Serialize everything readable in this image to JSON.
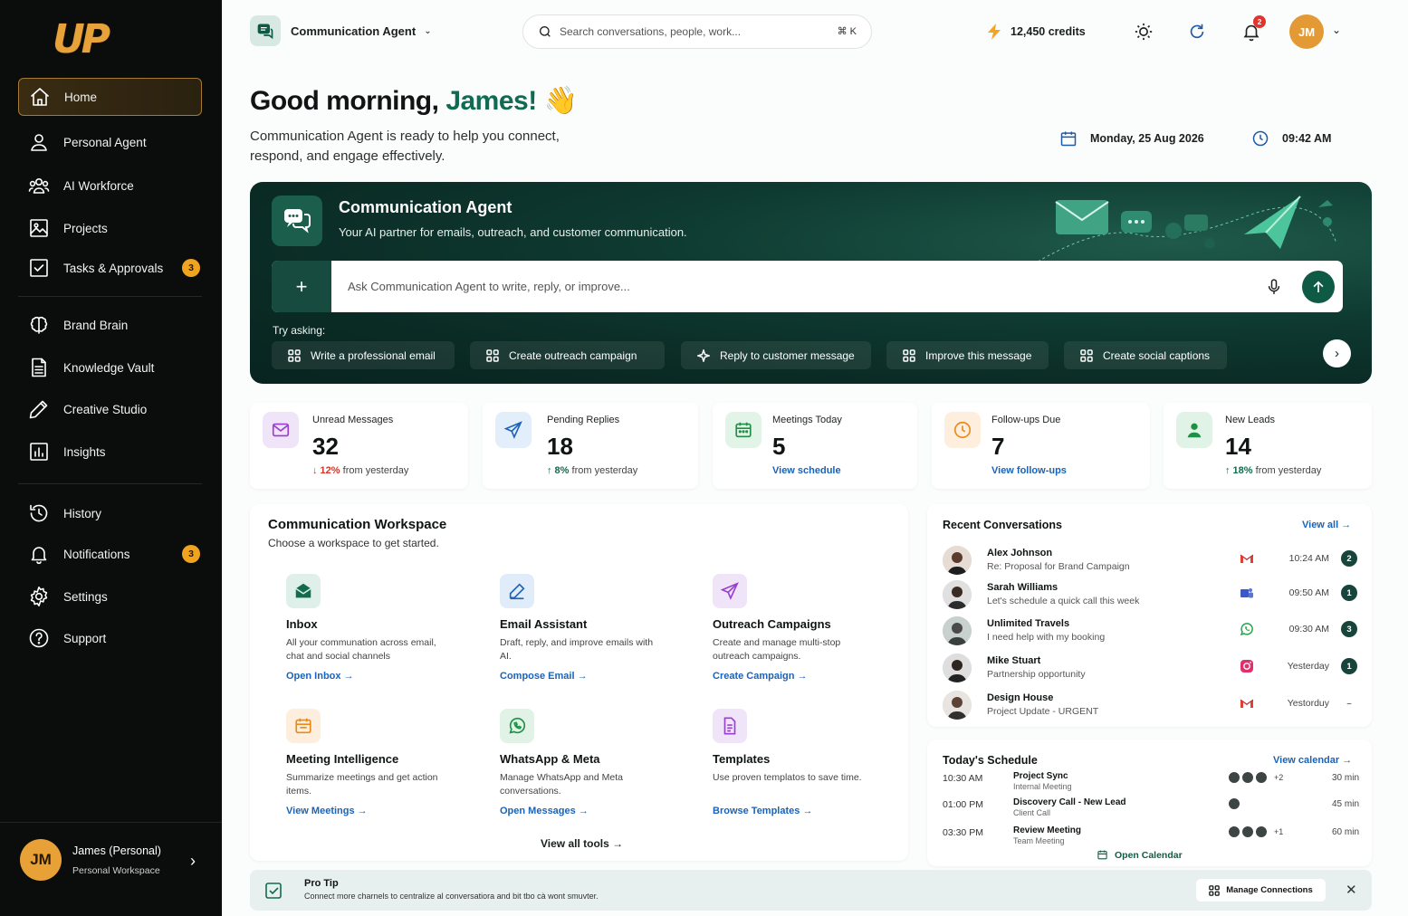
{
  "sidebar": {
    "logo": "UP",
    "items": [
      {
        "label": "Home",
        "icon": "home-icon"
      },
      {
        "label": "Personal Agent",
        "icon": "person-icon"
      },
      {
        "label": "AI Workforce",
        "icon": "team-icon"
      },
      {
        "label": "Projects",
        "icon": "image-icon"
      },
      {
        "label": "Tasks & Approvals",
        "icon": "checkbox-icon",
        "badge": "3"
      },
      {
        "label": "Brand Brain",
        "icon": "brain-icon"
      },
      {
        "label": "Knowledge Vault",
        "icon": "document-icon"
      },
      {
        "label": "Creative Studio",
        "icon": "pen-icon"
      },
      {
        "label": "Insights",
        "icon": "chart-icon"
      },
      {
        "label": "History",
        "icon": "history-icon"
      },
      {
        "label": "Notifications",
        "icon": "bell-icon",
        "badge": "3"
      },
      {
        "label": "Settings",
        "icon": "gear-icon"
      },
      {
        "label": "Support",
        "icon": "help-icon"
      }
    ],
    "user": {
      "initials": "JM",
      "name": "James (Personal)",
      "workspace": "Personal Workspace"
    }
  },
  "topbar": {
    "agent": "Communication Agent",
    "search_placeholder": "Search conversations, people, work...",
    "shortcut": "⌘ K",
    "credits": "12,450 credits",
    "notifications": "2",
    "initials": "JM"
  },
  "header": {
    "greeting": "Good morning, ",
    "name": "James!",
    "emoji": "👋",
    "subtitle": "Communication Agent is ready to help you connect, respond, and engage effectively.",
    "date": "Monday, 25 Aug 2026",
    "time": "09:42 AM"
  },
  "hero": {
    "title": "Communication Agent",
    "subtitle": "Your AI partner for emails, outreach, and customer communication.",
    "ask_placeholder": "Ask Communication Agent to write, reply, or improve...",
    "try_label": "Try asking:",
    "chips": [
      "Write a professional email",
      "Create outreach campaign",
      "Reply to customer message",
      "Improve this message",
      "Create social captions"
    ]
  },
  "stats": [
    {
      "label": "Unread Messages",
      "value": "32",
      "delta": "↓ 12%",
      "foot": " from yesterday",
      "color": "#efe4f8"
    },
    {
      "label": "Pending Replies",
      "value": "18",
      "delta": "↑ 8%",
      "foot": " from yesterday",
      "color": "#e3eefb"
    },
    {
      "label": "Meetings Today",
      "value": "5",
      "link": "View schedule",
      "color": "#e2f3e8"
    },
    {
      "label": "Follow-ups Due",
      "value": "7",
      "link": "View follow-ups",
      "color": "#fdeedd"
    },
    {
      "label": "New Leads",
      "value": "14",
      "delta": "↑ 18%",
      "foot": " from yesterday",
      "color": "#e1f3e6"
    }
  ],
  "workspace": {
    "title": "Communication Workspace",
    "subtitle": "Choose a workspace to get started.",
    "tools": [
      {
        "name": "Inbox",
        "desc": "All your communation across email, chat and social channels",
        "link": "Open Inbox"
      },
      {
        "name": "Email Assistant",
        "desc": "Draft, reply, and improve emails with AI.",
        "link": "Compose Email"
      },
      {
        "name": "Outreach Campaigns",
        "desc": "Create and manage multi-stop outreach campaigns.",
        "link": "Create Campaign"
      },
      {
        "name": "Meeting Intelligence",
        "desc": "Summarize meetings and get action items.",
        "link": "View Meetings"
      },
      {
        "name": "WhatsApp & Meta",
        "desc": "Manage WhatsApp and Meta conversations.",
        "link": "Open Messages"
      },
      {
        "name": "Templates",
        "desc": "Use proven templatos to save time.",
        "link": "Browse Templates"
      }
    ],
    "view_all": "View all tools"
  },
  "recent": {
    "title": "Recent Conversations",
    "view_all": "View all",
    "items": [
      {
        "name": "Alex Johnson",
        "msg": "Re: Proposal for Brand Campaign",
        "app": "gmail-icon",
        "time": "10:24 AM",
        "count": "2"
      },
      {
        "name": "Sarah Williams",
        "msg": "Let's schedule a quick call this week",
        "app": "teams-icon",
        "time": "09:50 AM",
        "count": "1"
      },
      {
        "name": "Unlimited Travels",
        "msg": "I need help with my booking",
        "app": "whatsapp-icon",
        "time": "09:30 AM",
        "count": "3"
      },
      {
        "name": "Mike Stuart",
        "msg": "Partnership opportunity",
        "app": "instagram-icon",
        "time": "Yesterday",
        "count": "1"
      },
      {
        "name": "Design House",
        "msg": "Project Update - URGENT",
        "app": "gmail-icon",
        "time": "Yestorduy",
        "count": "–"
      }
    ]
  },
  "schedule": {
    "title": "Today's Schedule",
    "view": "View calendar",
    "items": [
      {
        "time": "10:30 AM",
        "title": "Project Sync",
        "type": "Internal Meeting",
        "people": 3,
        "more": "+2",
        "dur": "30 min"
      },
      {
        "time": "01:00 PM",
        "title": "Discovery Call - New Lead",
        "type": "Client Call",
        "people": 1,
        "more": "",
        "dur": "45 min"
      },
      {
        "time": "03:30 PM",
        "title": "Review Meeting",
        "type": "Team Meeting",
        "people": 3,
        "more": "+1",
        "dur": "60 min"
      }
    ],
    "open": "Open Calendar"
  },
  "pro_tip": {
    "title": "Pro Tip",
    "text": "Connect more charnels to centralize al conversatiora and bit tbo cà wont smuvter.",
    "button": "Manage Connections"
  },
  "colors": {
    "brand": "#0f6b51",
    "accent": "#e8a136",
    "link": "#1a63b8"
  }
}
